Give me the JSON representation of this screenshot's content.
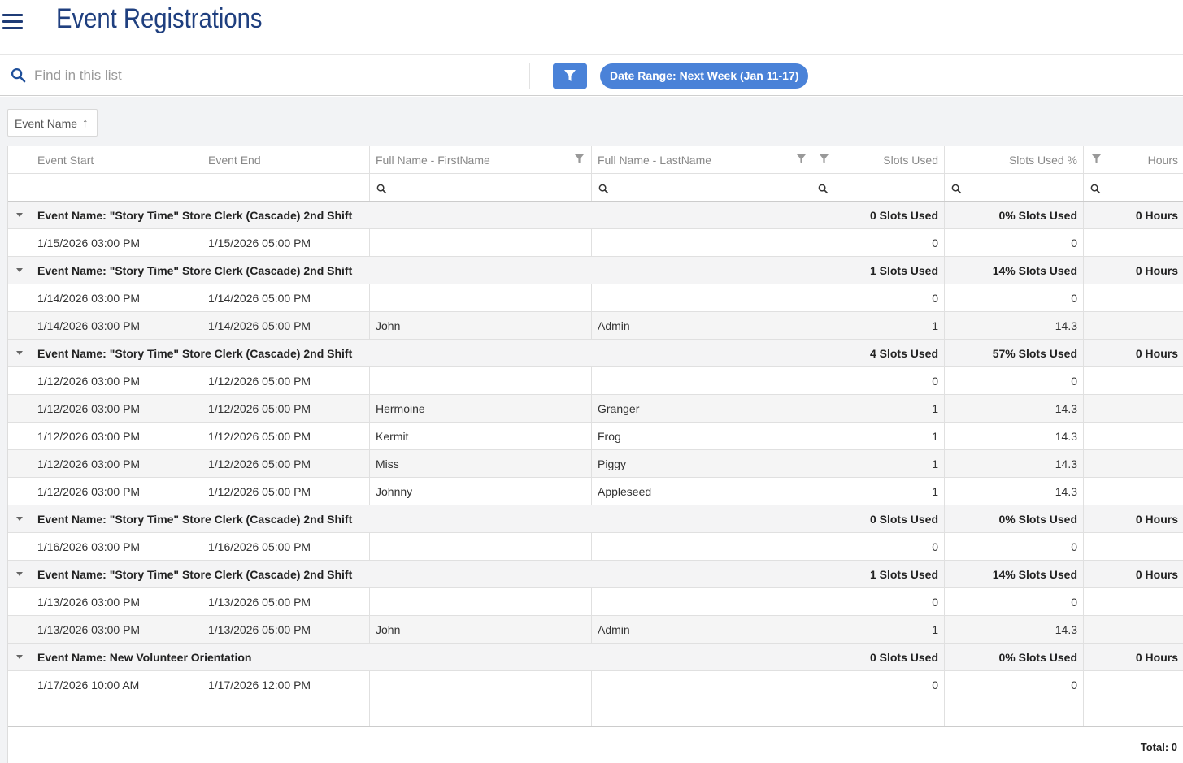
{
  "header": {
    "title": "Event Registrations"
  },
  "toolbar": {
    "search_placeholder": "Find in this list",
    "date_chip": "Date Range: Next Week (Jan 11-17)"
  },
  "grouping": {
    "chip_label": "Event Name",
    "sort_arrow": "↑"
  },
  "columns": [
    "Event Start",
    "Event End",
    "Full Name - FirstName",
    "Full Name - LastName",
    "Slots Used",
    "Slots Used %",
    "Hours"
  ],
  "groups": [
    {
      "label": "Event Name: \"Story Time\" Store Clerk (Cascade) 2nd Shift",
      "slots": "0 Slots Used",
      "pct": "0% Slots Used",
      "hours": "0 Hours",
      "rows": [
        {
          "start": "1/15/2026 03:00 PM",
          "end": "1/15/2026 05:00 PM",
          "first": "",
          "last": "",
          "slots": "0",
          "pct": "0",
          "hours": ""
        }
      ]
    },
    {
      "label": "Event Name: \"Story Time\" Store Clerk (Cascade) 2nd Shift",
      "slots": "1 Slots Used",
      "pct": "14% Slots Used",
      "hours": "0 Hours",
      "rows": [
        {
          "start": "1/14/2026 03:00 PM",
          "end": "1/14/2026 05:00 PM",
          "first": "",
          "last": "",
          "slots": "0",
          "pct": "0",
          "hours": ""
        },
        {
          "start": "1/14/2026 03:00 PM",
          "end": "1/14/2026 05:00 PM",
          "first": "John",
          "last": "Admin",
          "slots": "1",
          "pct": "14.3",
          "hours": ""
        }
      ]
    },
    {
      "label": "Event Name: \"Story Time\" Store Clerk (Cascade) 2nd Shift",
      "slots": "4 Slots Used",
      "pct": "57% Slots Used",
      "hours": "0 Hours",
      "rows": [
        {
          "start": "1/12/2026 03:00 PM",
          "end": "1/12/2026 05:00 PM",
          "first": "",
          "last": "",
          "slots": "0",
          "pct": "0",
          "hours": ""
        },
        {
          "start": "1/12/2026 03:00 PM",
          "end": "1/12/2026 05:00 PM",
          "first": "Hermoine",
          "last": "Granger",
          "slots": "1",
          "pct": "14.3",
          "hours": ""
        },
        {
          "start": "1/12/2026 03:00 PM",
          "end": "1/12/2026 05:00 PM",
          "first": "Kermit",
          "last": "Frog",
          "slots": "1",
          "pct": "14.3",
          "hours": ""
        },
        {
          "start": "1/12/2026 03:00 PM",
          "end": "1/12/2026 05:00 PM",
          "first": "Miss",
          "last": "Piggy",
          "slots": "1",
          "pct": "14.3",
          "hours": ""
        },
        {
          "start": "1/12/2026 03:00 PM",
          "end": "1/12/2026 05:00 PM",
          "first": "Johnny",
          "last": "Appleseed",
          "slots": "1",
          "pct": "14.3",
          "hours": ""
        }
      ]
    },
    {
      "label": "Event Name: \"Story Time\" Store Clerk (Cascade) 2nd Shift",
      "slots": "0 Slots Used",
      "pct": "0% Slots Used",
      "hours": "0 Hours",
      "rows": [
        {
          "start": "1/16/2026 03:00 PM",
          "end": "1/16/2026 05:00 PM",
          "first": "",
          "last": "",
          "slots": "0",
          "pct": "0",
          "hours": ""
        }
      ]
    },
    {
      "label": "Event Name: \"Story Time\" Store Clerk (Cascade) 2nd Shift",
      "slots": "1 Slots Used",
      "pct": "14% Slots Used",
      "hours": "0 Hours",
      "rows": [
        {
          "start": "1/13/2026 03:00 PM",
          "end": "1/13/2026 05:00 PM",
          "first": "",
          "last": "",
          "slots": "0",
          "pct": "0",
          "hours": ""
        },
        {
          "start": "1/13/2026 03:00 PM",
          "end": "1/13/2026 05:00 PM",
          "first": "John",
          "last": "Admin",
          "slots": "1",
          "pct": "14.3",
          "hours": ""
        }
      ]
    },
    {
      "label": "Event Name: New Volunteer Orientation",
      "slots": "0 Slots Used",
      "pct": "0% Slots Used",
      "hours": "0 Hours",
      "rows": [
        {
          "start": "1/17/2026 10:00 AM",
          "end": "1/17/2026 12:00 PM",
          "first": "",
          "last": "",
          "slots": "0",
          "pct": "0",
          "hours": ""
        }
      ]
    }
  ],
  "footer": {
    "total": "Total: 0"
  },
  "colors": {
    "brand": "#1f3f7f",
    "accent": "#4a82d8"
  }
}
